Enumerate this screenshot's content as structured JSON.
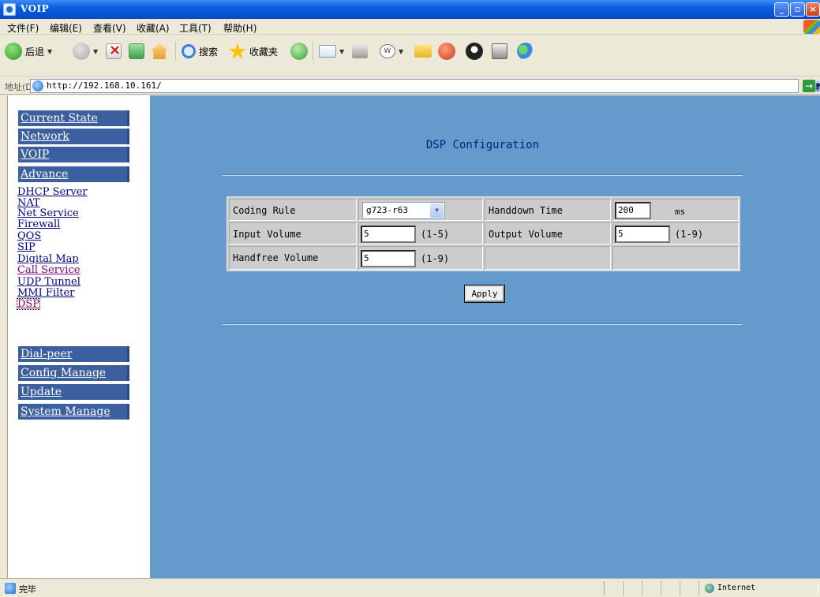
{
  "window": {
    "title": "VOIP"
  },
  "menubar": [
    "文件(F)",
    "编辑(E)",
    "查看(V)",
    "收藏(A)",
    "工具(T)",
    "帮助(H)"
  ],
  "toolbar": {
    "back": "后退",
    "search": "搜索",
    "favorites": "收藏夹"
  },
  "address": {
    "label": "地址(D)",
    "url": "http://192.168.10.161/",
    "go": "转到"
  },
  "sidebar": {
    "sections": {
      "current_state": "Current State",
      "network": "Network",
      "voip": "VOIP",
      "advance": "Advance",
      "dial_peer": "Dial-peer",
      "config_manage": "Config Manage",
      "update": "Update",
      "system_manage": "System Manage"
    },
    "advance_items": [
      "DHCP Server",
      "NAT",
      "Net Service",
      "Firewall",
      "QOS",
      "SIP",
      "Digital Map",
      "Call Service",
      "UDP Tunnel",
      "MMI Filter",
      "DSP"
    ]
  },
  "main": {
    "title": "DSP Configuration",
    "fields": {
      "coding_rule_label": "Coding Rule",
      "coding_rule_value": "g723-r63",
      "handdown_label": "Handdown Time",
      "handdown_value": "200",
      "handdown_unit": "ms",
      "input_volume_label": "Input Volume",
      "input_volume_value": "5",
      "input_volume_range": "(1-5)",
      "output_volume_label": "Output Volume",
      "output_volume_value": "5",
      "output_volume_range": "(1-9)",
      "handfree_label": "Handfree Volume",
      "handfree_value": "5",
      "handfree_range": "(1-9)"
    },
    "apply": "Apply"
  },
  "status": {
    "text": "完毕",
    "zone": "Internet"
  }
}
